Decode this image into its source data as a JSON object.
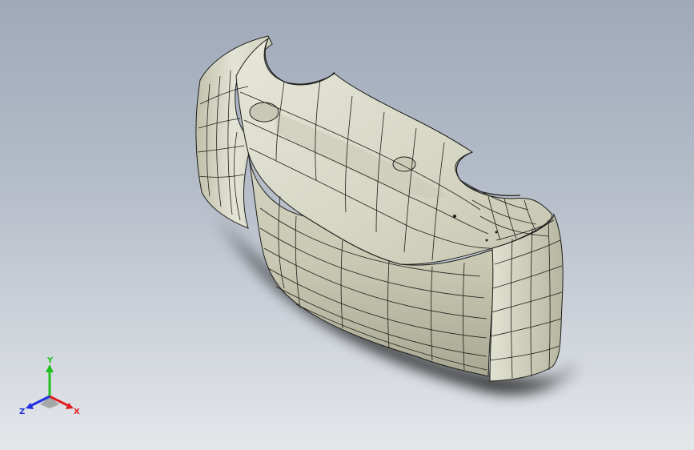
{
  "viewport": {
    "background_top": "#9fa9b9",
    "background_bottom": "#e4e7ea"
  },
  "model": {
    "surface_color": "#d8d8c6",
    "shade_color": "#b3b39e",
    "edge_color": "#1e1e1a"
  },
  "triad": {
    "x_label": "X",
    "y_label": "Y",
    "z_label": "Z",
    "x_color": "#e02020",
    "y_color": "#20c020",
    "z_color": "#2030e0"
  }
}
